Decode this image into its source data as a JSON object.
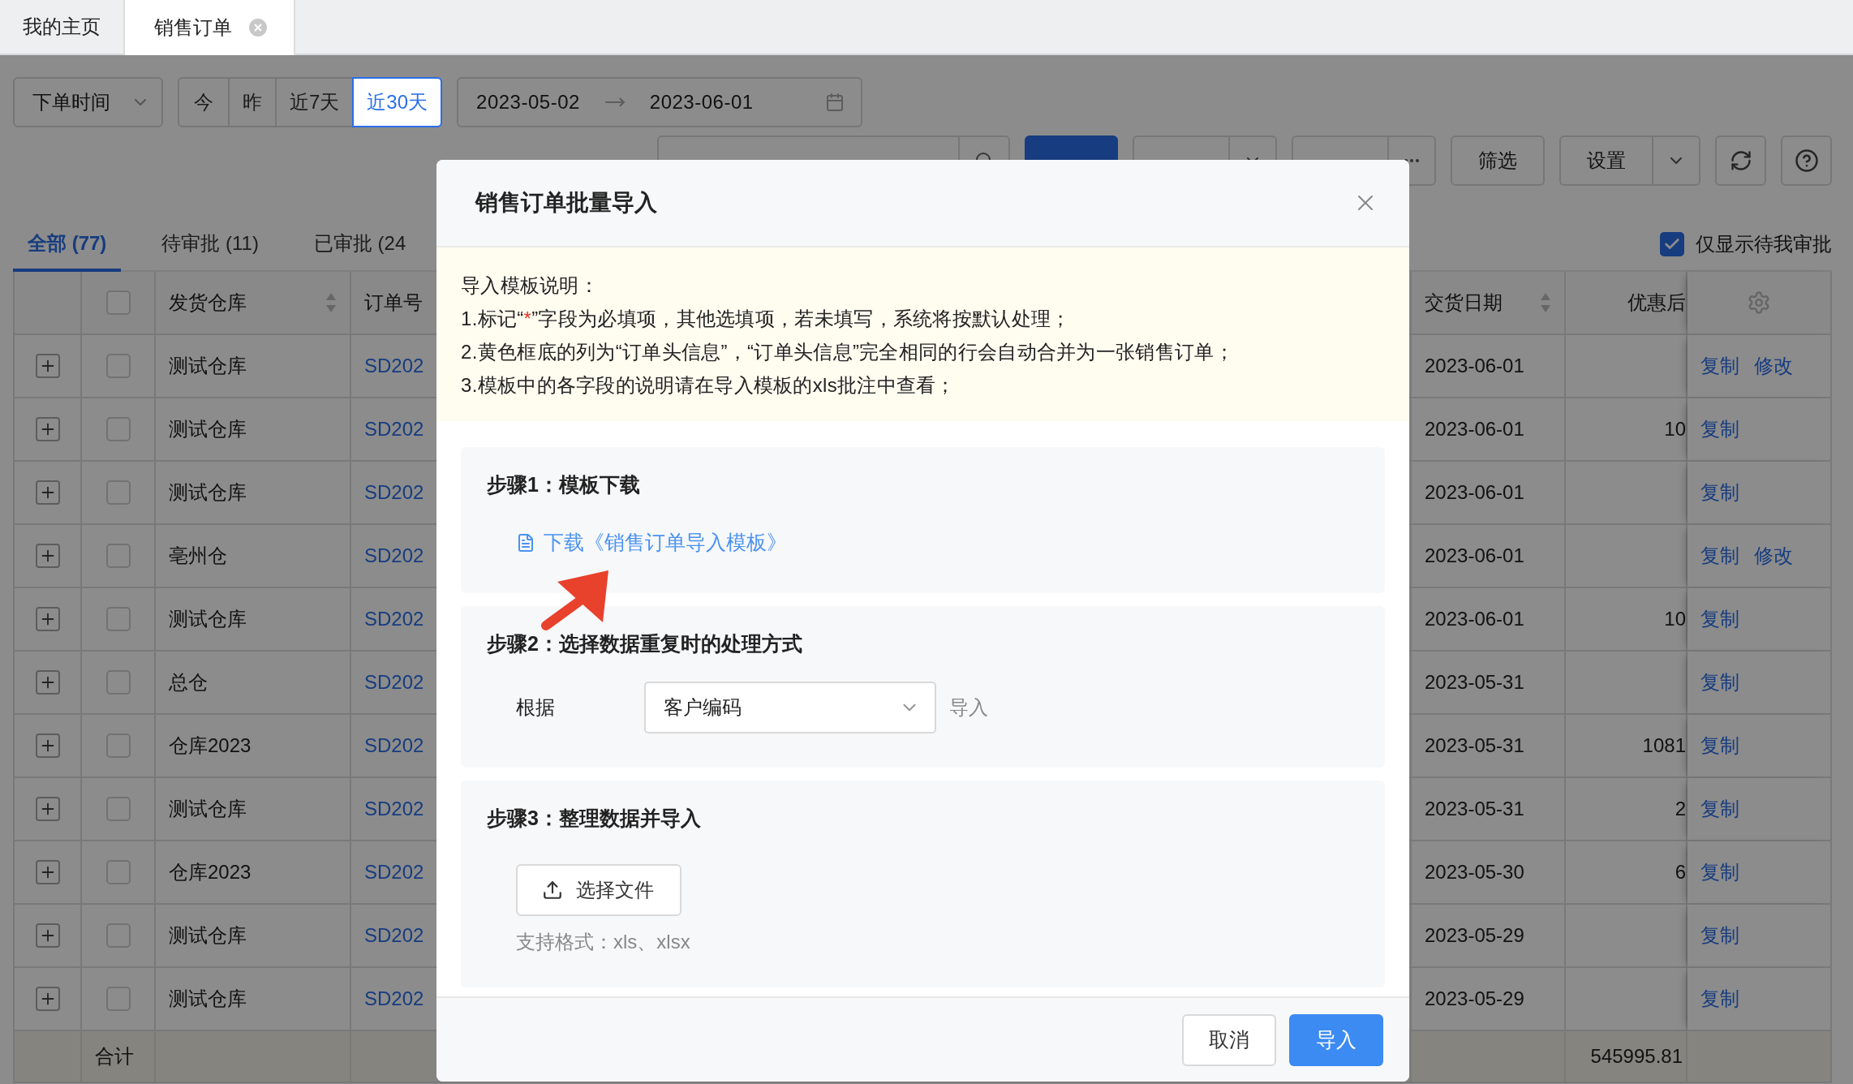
{
  "page_tabs": [
    {
      "label": "我的主页",
      "selected": false,
      "closable": false
    },
    {
      "label": "销售订单",
      "selected": true,
      "closable": true
    }
  ],
  "filters": {
    "time_field": "下单时间",
    "quick_ranges": [
      {
        "label": "今",
        "selected": false
      },
      {
        "label": "昨",
        "selected": false
      },
      {
        "label": "近7天",
        "selected": false
      },
      {
        "label": "近30天",
        "selected": true
      }
    ],
    "date_from": "2023-05-02",
    "date_to": "2023-06-01"
  },
  "toolbar": {
    "buttons": [
      {
        "kind": "primary"
      },
      {
        "kind": "split"
      },
      {
        "kind": "more"
      },
      {
        "label": "筛选",
        "kind": "plain"
      },
      {
        "label": "设置",
        "kind": "split"
      }
    ]
  },
  "status_tabs": [
    {
      "label": "全部 (77)",
      "selected": true
    },
    {
      "label": "待审批 (11)",
      "selected": false
    },
    {
      "label": "已审批 (24",
      "selected": false
    }
  ],
  "only_mine": {
    "label": "仅显示待我审批",
    "checked": true
  },
  "table": {
    "columns": [
      "发货仓库",
      "订单号",
      "交货日期",
      "优惠后"
    ],
    "select_all": false,
    "rows": [
      {
        "checked": false,
        "warehouse": "测试仓库",
        "order": "SD202",
        "date": "2023-06-01",
        "amount": "",
        "actions": [
          "复制",
          "修改"
        ]
      },
      {
        "checked": false,
        "warehouse": "测试仓库",
        "order": "SD202",
        "date": "2023-06-01",
        "amount": "10",
        "actions": [
          "复制"
        ]
      },
      {
        "checked": false,
        "warehouse": "测试仓库",
        "order": "SD202",
        "date": "2023-06-01",
        "amount": "",
        "actions": [
          "复制"
        ]
      },
      {
        "checked": false,
        "warehouse": "亳州仓",
        "order": "SD202",
        "date": "2023-06-01",
        "amount": "",
        "actions": [
          "复制",
          "修改"
        ]
      },
      {
        "checked": false,
        "warehouse": "测试仓库",
        "order": "SD202",
        "date": "2023-06-01",
        "amount": "10",
        "actions": [
          "复制"
        ]
      },
      {
        "checked": false,
        "warehouse": "总仓",
        "order": "SD202",
        "date": "2023-05-31",
        "amount": "",
        "actions": [
          "复制"
        ]
      },
      {
        "checked": false,
        "warehouse": "仓库2023",
        "order": "SD202",
        "date": "2023-05-31",
        "amount": "1081",
        "actions": [
          "复制"
        ]
      },
      {
        "checked": false,
        "warehouse": "测试仓库",
        "order": "SD202",
        "date": "2023-05-31",
        "amount": "2",
        "actions": [
          "复制"
        ]
      },
      {
        "checked": false,
        "warehouse": "仓库2023",
        "order": "SD202",
        "date": "2023-05-30",
        "amount": "6",
        "actions": [
          "复制"
        ]
      },
      {
        "checked": false,
        "warehouse": "测试仓库",
        "order": "SD202",
        "date": "2023-05-29",
        "amount": "",
        "actions": [
          "复制"
        ]
      },
      {
        "checked": false,
        "warehouse": "测试仓库",
        "order": "SD202",
        "date": "2023-05-29",
        "amount": "",
        "actions": [
          "复制"
        ]
      }
    ],
    "summary": {
      "label": "合计",
      "amount": "545995.81"
    }
  },
  "dialog": {
    "title": "销售订单批量导入",
    "notice": {
      "heading": "导入模板说明：",
      "lines": [
        [
          {
            "text": "1.标记“",
            "required": false
          },
          {
            "text": "*",
            "required": true
          },
          {
            "text": "”字段为必填项，其他选填项，若未填写，系统将按默认处理；",
            "required": false
          }
        ],
        [
          {
            "text": "2.黄色框底的列为“订单头信息”，“订单头信息”完全相同的行会自动合并为一张销售订单；",
            "required": false
          }
        ],
        [
          {
            "text": "3.模板中的各字段的说明请在导入模板的xls批注中查看；",
            "required": false
          }
        ]
      ]
    },
    "step1": {
      "title": "步骤1：模板下载",
      "link": "下载《销售订单导入模板》"
    },
    "step2": {
      "title": "步骤2：选择数据重复时的处理方式",
      "label": "根据",
      "value": "客户编码",
      "suffix": "导入"
    },
    "step3": {
      "title": "步骤3：整理数据并导入",
      "button": "选择文件",
      "hint": "支持格式：xls、xlsx"
    },
    "buttons": [
      {
        "label": "取消",
        "kind": "default"
      },
      {
        "label": "导入",
        "kind": "primary"
      }
    ]
  }
}
